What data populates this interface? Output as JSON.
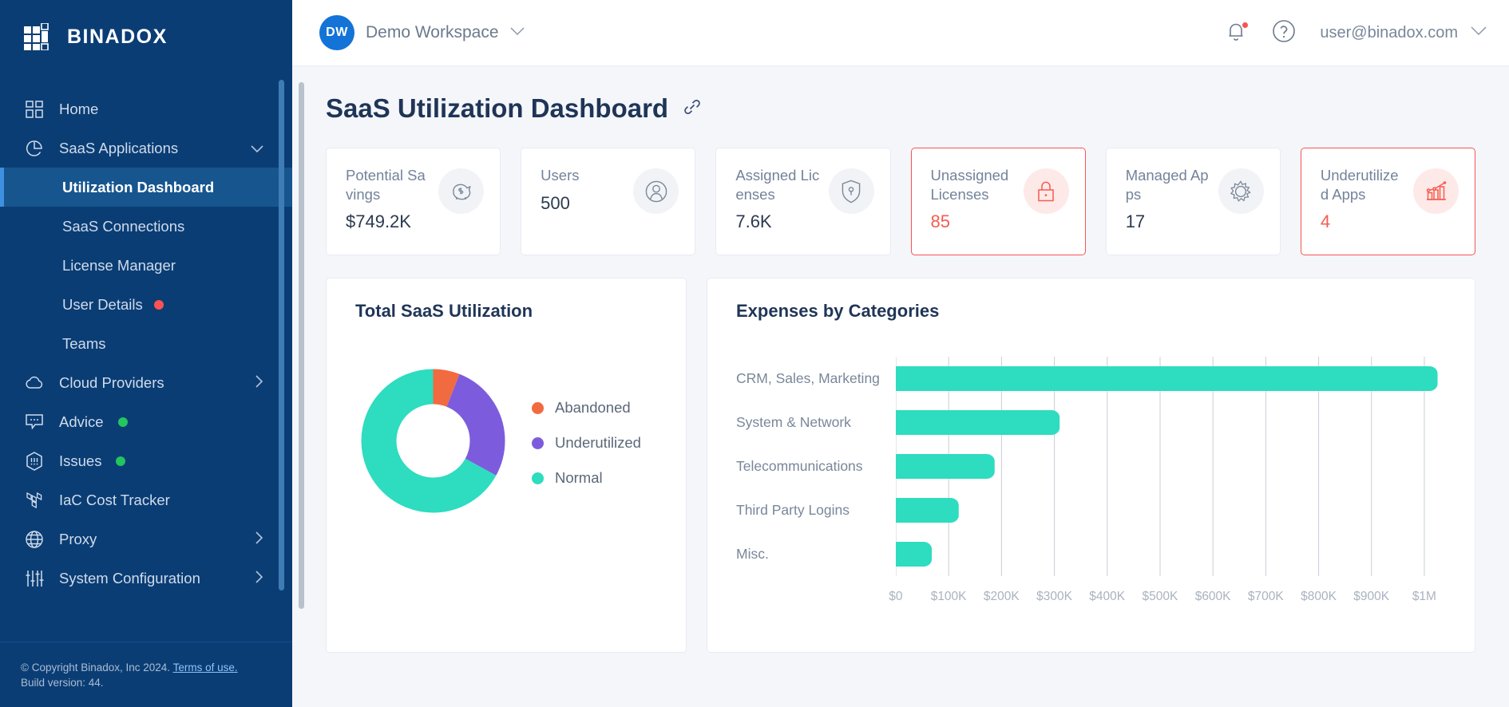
{
  "brand": {
    "name": "BINADOX",
    "logo_icon": "binadox-grid-logo"
  },
  "sidebar": {
    "items": [
      {
        "label": "Home",
        "icon": "dashboard-grid-icon",
        "type": "item",
        "badge": null,
        "chevron": null
      },
      {
        "label": "SaaS Applications",
        "icon": "pie-chart-icon",
        "type": "item",
        "badge": null,
        "chevron": "chevron-down"
      },
      {
        "label": "Utilization Dashboard",
        "icon": null,
        "type": "sub",
        "active": true,
        "badge": null,
        "chevron": null
      },
      {
        "label": "SaaS Connections",
        "icon": null,
        "type": "sub",
        "active": false,
        "badge": null,
        "chevron": null
      },
      {
        "label": "License Manager",
        "icon": null,
        "type": "sub",
        "active": false,
        "badge": null,
        "chevron": null
      },
      {
        "label": "User Details",
        "icon": null,
        "type": "sub",
        "active": false,
        "badge": "red",
        "chevron": null
      },
      {
        "label": "Teams",
        "icon": null,
        "type": "sub",
        "active": false,
        "badge": null,
        "chevron": null
      },
      {
        "label": "Cloud Providers",
        "icon": "cloud-icon",
        "type": "item",
        "badge": null,
        "chevron": "chevron-right"
      },
      {
        "label": "Advice",
        "icon": "speech-bubble-icon",
        "type": "item",
        "badge": "green",
        "chevron": null
      },
      {
        "label": "Issues",
        "icon": "hexagon-alert-icon",
        "type": "item",
        "badge": "green",
        "chevron": null
      },
      {
        "label": "IaC Cost Tracker",
        "icon": "terraform-icon",
        "type": "item",
        "badge": null,
        "chevron": null
      },
      {
        "label": "Proxy",
        "icon": "globe-icon",
        "type": "item",
        "badge": null,
        "chevron": "chevron-right"
      },
      {
        "label": "System Configuration",
        "icon": "sliders-icon",
        "type": "item",
        "badge": null,
        "chevron": "chevron-right"
      }
    ],
    "footer": {
      "copyright": "© Copyright Binadox, Inc 2024.",
      "terms_link": "Terms of use.",
      "build": "Build version: 44."
    }
  },
  "topbar": {
    "workspace_initials": "DW",
    "workspace_name": "Demo Workspace",
    "workspace_chevron_icon": "chevron-down-icon",
    "notification_icon": "bell-icon",
    "notification_badge": true,
    "help_icon": "question-circle-icon",
    "user_email": "user@binadox.com",
    "user_chevron_icon": "chevron-down-icon"
  },
  "page": {
    "title": "SaaS Utilization Dashboard",
    "link_icon": "link-chain-icon"
  },
  "kpis": [
    {
      "label": "Potential Savings",
      "value": "$749.2K",
      "icon": "piggy-bank-icon",
      "alert": false
    },
    {
      "label": "Users",
      "value": "500",
      "icon": "user-icon",
      "alert": false
    },
    {
      "label": "Assigned Licenses",
      "value": "7.6K",
      "icon": "shield-key-icon",
      "alert": false
    },
    {
      "label": "Unassigned Licenses",
      "value": "85",
      "icon": "lock-icon",
      "alert": true
    },
    {
      "label": "Managed Apps",
      "value": "17",
      "icon": "gear-icon",
      "alert": false
    },
    {
      "label": "Underutilized Apps",
      "value": "4",
      "icon": "chart-trend-icon",
      "alert": true
    }
  ],
  "panels": {
    "donut_title": "Total SaaS Utilization",
    "bars_title": "Expenses by Categories"
  },
  "colors": {
    "abandoned": "#f26a3f",
    "underutilized": "#7c5cdd",
    "normal": "#2edcc0",
    "alert": "#fb5252",
    "sidebar": "#0b3d75",
    "accent": "#1473d6"
  },
  "chart_data": [
    {
      "type": "pie",
      "title": "Total SaaS Utilization",
      "variant": "donut",
      "legend_position": "right",
      "labels": [
        "Abandoned",
        "Underutilized",
        "Normal"
      ],
      "values": [
        6,
        27,
        67
      ],
      "unit": "percent",
      "colors": [
        "#f26a3f",
        "#7c5cdd",
        "#2edcc0"
      ]
    },
    {
      "type": "bar",
      "orientation": "horizontal",
      "title": "Expenses by Categories",
      "categories": [
        "CRM, Sales, Marketing",
        "System & Network",
        "Telecommunications",
        "Third Party Logins",
        "Misc."
      ],
      "values": [
        1025000,
        310000,
        187000,
        119000,
        68000
      ],
      "series": [
        {
          "name": "Expenses",
          "values": [
            1025000,
            310000,
            187000,
            119000,
            68000
          ]
        }
      ],
      "xlabel": "",
      "ylabel": "",
      "xlim": [
        0,
        1050000
      ],
      "tick_values": [
        0,
        100000,
        200000,
        300000,
        400000,
        500000,
        600000,
        700000,
        800000,
        900000,
        1000000
      ],
      "tick_labels": [
        "$0",
        "$100K",
        "$200K",
        "$300K",
        "$400K",
        "$500K",
        "$600K",
        "$700K",
        "$800K",
        "$900K",
        "$1M"
      ],
      "grid": true,
      "bar_color": "#2edcc0"
    }
  ]
}
